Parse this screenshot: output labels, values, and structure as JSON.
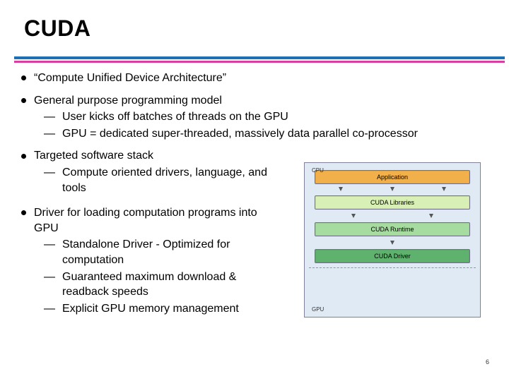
{
  "title": "CUDA",
  "bullets": [
    {
      "text": "“Compute Unified Device Architecture”",
      "sub": []
    },
    {
      "text": "General purpose programming model",
      "sub": [
        "User kicks off batches of threads on the GPU",
        "GPU = dedicated super-threaded, massively data parallel co-processor"
      ]
    },
    {
      "text": "Targeted software stack",
      "sub": [
        "Compute oriented drivers, language, and tools"
      ],
      "narrow": true
    },
    {
      "text": "Driver for loading computation programs into GPU",
      "sub": [
        "Standalone Driver - Optimized for computation",
        "Guaranteed maximum download & readback speeds",
        "Explicit GPU memory management"
      ],
      "narrow": true,
      "gap": true
    }
  ],
  "diagram": {
    "cpu_label": "CPU",
    "gpu_label": "GPU",
    "layers": {
      "application": "Application",
      "libraries": "CUDA Libraries",
      "runtime": "CUDA Runtime",
      "driver": "CUDA Driver"
    }
  },
  "page_number": "6"
}
